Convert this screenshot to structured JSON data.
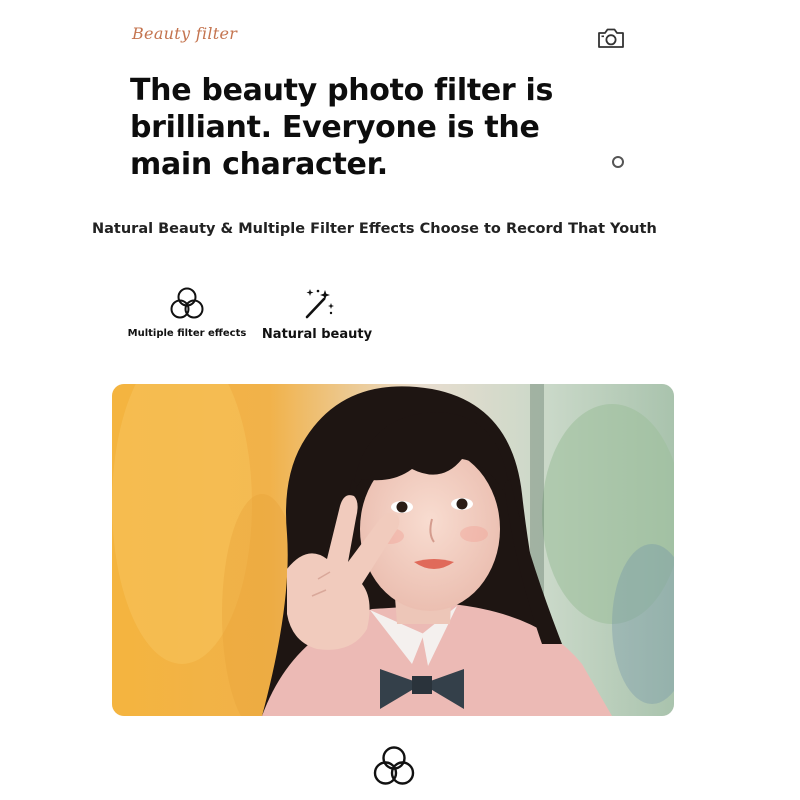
{
  "header": {
    "brand": "Beauty filter",
    "camera_icon": "camera-icon"
  },
  "hero": {
    "headline": "The beauty photo filter is brilliant. Everyone is the main character.",
    "subtitle": "Natural Beauty & Multiple Filter Effects Choose to Record That Youth"
  },
  "features": [
    {
      "label": "Multiple filter effects",
      "icon": "filter-circles-icon"
    },
    {
      "label": "Natural beauty",
      "icon": "magic-wand-icon"
    }
  ],
  "photo": {
    "description_icon": "portrait-photo",
    "colors": {
      "background_left": "#f2b13d",
      "background_right": "#b9cfc1",
      "hair": "#1e1512",
      "skin": "#f3d0c4",
      "shirt": "#eab8b4",
      "bow": "#34404a"
    }
  },
  "footer": {
    "icon": "filter-circles-icon"
  }
}
